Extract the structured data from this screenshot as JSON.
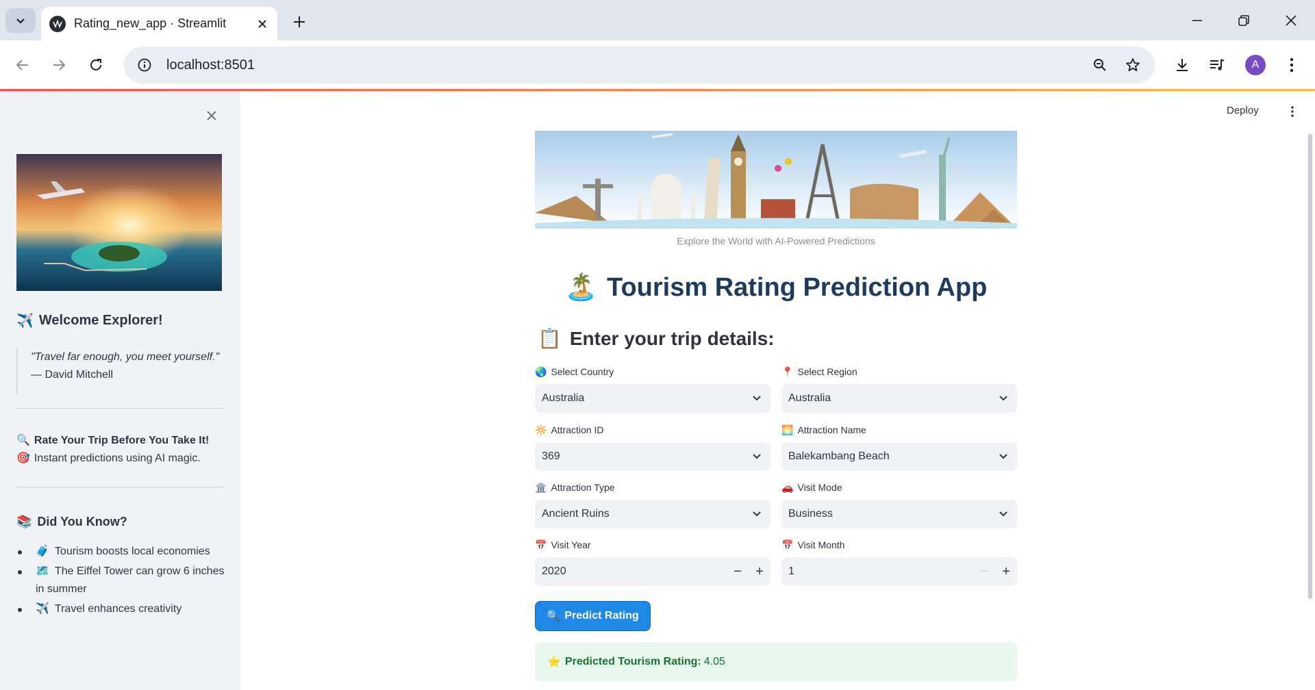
{
  "browser": {
    "tab_title": "Rating_new_app · Streamlit",
    "url": "localhost:8501",
    "profile_initial": "A"
  },
  "header": {
    "deploy_label": "Deploy"
  },
  "sidebar": {
    "welcome": "Welcome Explorer!",
    "welcome_emoji": "✈️",
    "quote": "\"Travel far enough, you meet yourself.\"",
    "quote_author": "— David Mitchell",
    "rate_emoji": "🔍",
    "rate_title": "Rate Your Trip Before You Take It!",
    "instant_emoji": "🎯",
    "instant_text": "Instant predictions using AI magic.",
    "did_you_know_emoji": "📚",
    "did_you_know": "Did You Know?",
    "facts": [
      {
        "emoji": "🧳",
        "text": "Tourism boosts local economies"
      },
      {
        "emoji": "🗺️",
        "text": "The Eiffel Tower can grow 6 inches in summer"
      },
      {
        "emoji": "✈️",
        "text": "Travel enhances creativity"
      }
    ]
  },
  "main": {
    "caption": "Explore the World with AI-Powered Predictions",
    "title_emoji": "🏝️",
    "title": "Tourism Rating Prediction App",
    "subhead_emoji": "📋",
    "subhead": "Enter your trip details:",
    "fields": {
      "country": {
        "emoji": "🌏",
        "label": "Select Country",
        "value": "Australia"
      },
      "region": {
        "emoji": "📍",
        "label": "Select Region",
        "value": "Australia"
      },
      "attraction_id": {
        "emoji": "🔆",
        "label": "Attraction ID",
        "value": "369"
      },
      "attraction_name": {
        "emoji": "🌅",
        "label": "Attraction Name",
        "value": "Balekambang Beach"
      },
      "attraction_type": {
        "emoji": "🏛️",
        "label": "Attraction Type",
        "value": "Ancient Ruins"
      },
      "visit_mode": {
        "emoji": "🚗",
        "label": "Visit Mode",
        "value": "Business"
      },
      "visit_year": {
        "emoji": "📅",
        "label": "Visit Year",
        "value": "2020"
      },
      "visit_month": {
        "emoji": "📅",
        "label": "Visit Month",
        "value": "1"
      }
    },
    "predict_emoji": "🔍",
    "predict_label": "Predict Rating",
    "result_emoji": "⭐",
    "result_label": "Predicted Tourism Rating:",
    "result_value": "4.05"
  }
}
